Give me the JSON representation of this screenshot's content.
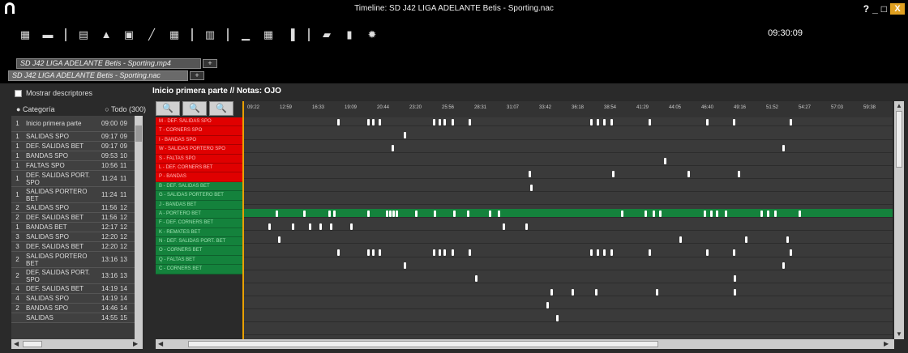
{
  "window": {
    "title": "Timeline: SD J42 LIGA ADELANTE Betis - Sporting.nac",
    "help": "?",
    "minimize": "_",
    "maximize": "□",
    "close": "X"
  },
  "toolbar": {
    "icons": [
      "grid-icon",
      "monitor-icon",
      "separator",
      "notebook-icon",
      "image-icon",
      "window-icon",
      "pen-icon",
      "table-icon",
      "separator",
      "film-icon",
      "separator",
      "chart-icon",
      "grid-table-icon",
      "bar-chart-icon",
      "separator",
      "folder-icon",
      "document-icon",
      "gear-icon"
    ],
    "clock": "09:30:09"
  },
  "tabs": {
    "row1": "SD J42 LIGA ADELANTE Betis - Sporting.mp4",
    "row2": "SD J42 LIGA ADELANTE Betis - Sporting.nac",
    "add": "+"
  },
  "left": {
    "show_descriptors": "Mostrar descriptores",
    "radio_category": "Categoría",
    "radio_all": "Todo (300)",
    "rows": [
      {
        "n": "1",
        "name": "Inicio primera parte",
        "time": "09:00",
        "cut": "09"
      },
      {
        "n": "1",
        "name": "SALIDAS SPO",
        "time": "09:17",
        "cut": "09"
      },
      {
        "n": "1",
        "name": "DEF. SALIDAS BET",
        "time": "09:17",
        "cut": "09"
      },
      {
        "n": "1",
        "name": "BANDAS SPO",
        "time": "09:53",
        "cut": "10"
      },
      {
        "n": "1",
        "name": "FALTAS SPO",
        "time": "10:56",
        "cut": "11"
      },
      {
        "n": "1",
        "name": "DEF. SALIDAS PORT. SPO",
        "time": "11:24",
        "cut": "11"
      },
      {
        "n": "1",
        "name": "SALIDAS PORTERO BET",
        "time": "11:24",
        "cut": "11"
      },
      {
        "n": "2",
        "name": "SALIDAS SPO",
        "time": "11:56",
        "cut": "12"
      },
      {
        "n": "2",
        "name": "DEF. SALIDAS BET",
        "time": "11:56",
        "cut": "12"
      },
      {
        "n": "1",
        "name": "BANDAS BET",
        "time": "12:17",
        "cut": "12"
      },
      {
        "n": "3",
        "name": "SALIDAS SPO",
        "time": "12:20",
        "cut": "12"
      },
      {
        "n": "3",
        "name": "DEF. SALIDAS BET",
        "time": "12:20",
        "cut": "12"
      },
      {
        "n": "2",
        "name": "SALIDAS PORTERO BET",
        "time": "13:16",
        "cut": "13"
      },
      {
        "n": "2",
        "name": "DEF. SALIDAS PORT. SPO",
        "time": "13:16",
        "cut": "13"
      },
      {
        "n": "4",
        "name": "DEF. SALIDAS BET",
        "time": "14:19",
        "cut": "14"
      },
      {
        "n": "4",
        "name": "SALIDAS SPO",
        "time": "14:19",
        "cut": "14"
      },
      {
        "n": "2",
        "name": "BANDAS SPO",
        "time": "14:46",
        "cut": "14"
      },
      {
        "n": "",
        "name": "SALIDAS",
        "time": "14:55",
        "cut": "15"
      }
    ]
  },
  "timeline": {
    "header": "Inicio primera parte // Notas: OJO",
    "ticks": [
      "09:22",
      "12:59",
      "16:33",
      "19:09",
      "20:44",
      "23:20",
      "25:56",
      "28:31",
      "31:07",
      "33:42",
      "36:18",
      "38:54",
      "41:29",
      "44:05",
      "46:40",
      "49:16",
      "51:52",
      "54:27",
      "57:03",
      "59:38"
    ],
    "labels_red": [
      "M - DEF. SALIDAS SPO",
      "T - CORNERS SPO",
      "I - BANDAS SPO",
      "W - SALIDAS PORTERO SPO",
      "S - FALTAS SPO",
      "L - DEF. CORNERS BET",
      "P - BANDAS"
    ],
    "labels_green": [
      "B - DEF. SALIDAS BET",
      "G - SALIDAS PORTERO BET",
      "J - BANDAS BET",
      "A - PORTERO BET",
      "F - DEF. CORNERS BET",
      "K - REMATES BET",
      "N - DEF. SALIDAS PORT. BET",
      "O - CORNERS BET",
      "Q - FALTAS BET",
      "C - CORNERS BET"
    ],
    "events": [
      [
        115,
        152,
        158,
        166,
        233,
        240,
        246,
        256,
        277,
        427,
        435,
        443,
        452,
        499,
        570,
        603,
        673
      ],
      [
        197
      ],
      [
        182,
        664
      ],
      [
        518
      ],
      [
        351,
        454,
        547,
        609
      ],
      [
        353
      ],
      [],
      [
        39,
        73,
        104,
        110,
        152,
        175,
        179,
        183,
        187,
        211,
        234,
        258,
        275,
        302,
        313,
        465,
        494,
        504,
        512,
        567,
        575,
        582,
        593,
        637,
        645,
        654,
        684
      ],
      [
        30,
        59,
        80,
        93,
        106,
        131,
        319,
        347
      ],
      [
        42,
        537,
        618,
        669
      ],
      [
        115,
        152,
        158,
        166,
        233,
        240,
        246,
        256,
        277,
        427,
        435,
        443,
        452,
        499,
        570,
        603,
        673
      ],
      [
        197,
        664
      ],
      [
        285,
        604
      ],
      [
        378,
        404,
        433,
        508,
        604
      ],
      [
        373
      ],
      [
        385
      ],
      []
    ]
  }
}
